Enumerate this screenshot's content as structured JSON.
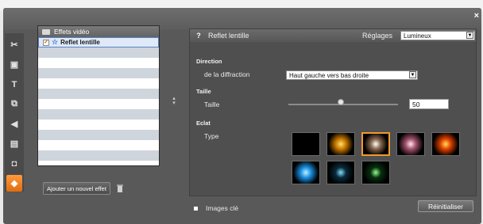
{
  "window": {
    "close_symbol": "×"
  },
  "toolbar": {
    "tools": [
      {
        "name": "scissors-icon",
        "glyph": "✂",
        "active": false
      },
      {
        "name": "image-icon",
        "glyph": "▣",
        "active": false
      },
      {
        "name": "text-icon",
        "glyph": "T",
        "active": false
      },
      {
        "name": "effects-icon",
        "glyph": "⧉",
        "active": false
      },
      {
        "name": "audio-icon",
        "glyph": "◀",
        "active": false
      },
      {
        "name": "clapper-icon",
        "glyph": "▤",
        "active": false
      },
      {
        "name": "film-icon",
        "glyph": "◘",
        "active": false
      },
      {
        "name": "video-fx-icon",
        "glyph": "◆",
        "active": true
      }
    ]
  },
  "effects_list": {
    "header_label": "Effets vidéo",
    "items": [
      {
        "label": "Reflet lentille",
        "checked": true,
        "selected": true
      }
    ],
    "add_button_label": "Ajouter un nouvel effet"
  },
  "effect_panel": {
    "help_glyph": "?",
    "title": "Reflet lentille",
    "reglages_label": "Réglages",
    "preset_value": "Lumineux",
    "direction_section": "Direction",
    "diffraction_label": "de la diffraction",
    "diffraction_value": "Haut gauche vers bas droite",
    "taille_section": "Taille",
    "taille_label": "Taille",
    "taille_value": "50",
    "taille_slider_fraction": 0.48,
    "eclat_section": "Eclat",
    "type_label": "Type",
    "swatches": [
      {
        "name": "flare-swatch-black",
        "colors": [
          "#000000",
          "#000000"
        ],
        "selected": false
      },
      {
        "name": "flare-swatch-gold",
        "colors": [
          "#ffe066",
          "#c87800"
        ],
        "selected": false
      },
      {
        "name": "flare-swatch-white",
        "colors": [
          "#ffffff",
          "#8a6a50"
        ],
        "selected": true
      },
      {
        "name": "flare-swatch-pink",
        "colors": [
          "#ffe6ef",
          "#a0506a"
        ],
        "selected": false
      },
      {
        "name": "flare-swatch-orange",
        "colors": [
          "#ffdd55",
          "#e04000"
        ],
        "selected": false
      },
      {
        "name": "flare-swatch-blue",
        "colors": [
          "#bff1ff",
          "#1a8fe0"
        ],
        "selected": false
      },
      {
        "name": "flare-swatch-teal",
        "colors": [
          "#7fe0ff",
          "#0a2a3a"
        ],
        "selected": false
      },
      {
        "name": "flare-swatch-green",
        "colors": [
          "#90ff8a",
          "#083010"
        ],
        "selected": false
      }
    ]
  },
  "footer": {
    "keyframes_label": "Images clé",
    "reset_label": "Réinitialiser"
  },
  "colors": {
    "accent_orange": "#f09a2e",
    "selection_blue": "#5a84c6"
  }
}
